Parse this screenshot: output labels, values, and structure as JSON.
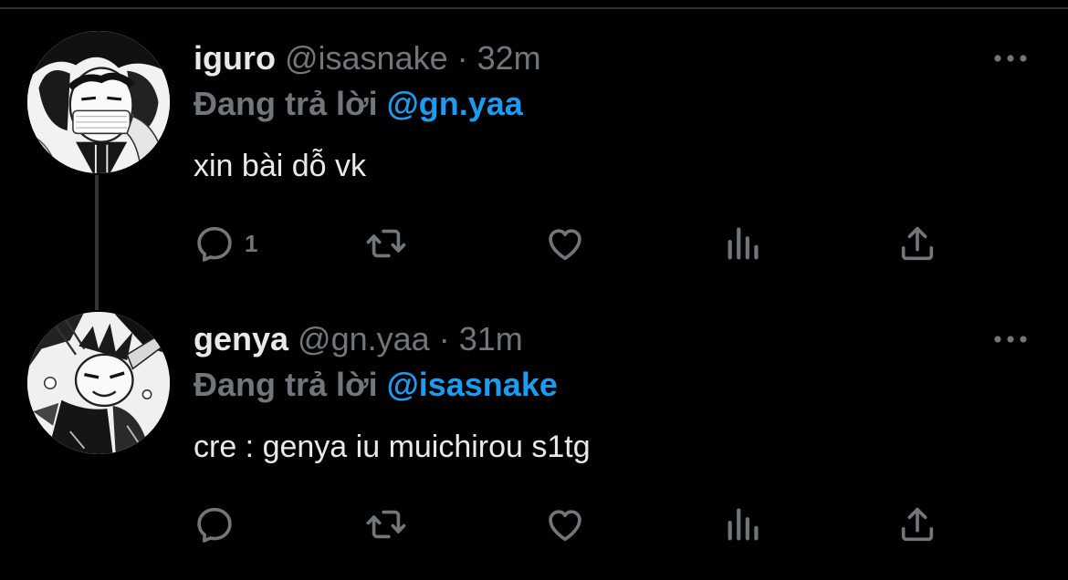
{
  "tweets": [
    {
      "name": "iguro",
      "handle": "@isasnake",
      "separator": "·",
      "time": "32m",
      "reply_prefix": "Đang trả lời",
      "reply_to": "@gn.yaa",
      "text": "xin bài dỗ vk",
      "reply_count": "1",
      "avatar_icon": "avatar-iguro",
      "more_icon": "more-icon"
    },
    {
      "name": "genya",
      "handle": "@gn.yaa",
      "separator": "·",
      "time": "31m",
      "reply_prefix": "Đang trả lời",
      "reply_to": "@isasnake",
      "text": "cre : genya iu muichirou s1tg",
      "reply_count": "",
      "avatar_icon": "avatar-genya",
      "more_icon": "more-icon"
    }
  ],
  "action_icons": [
    "reply-icon",
    "retweet-icon",
    "like-icon",
    "views-icon",
    "share-icon"
  ],
  "colors": {
    "background": "#000000",
    "text": "#e7e9ea",
    "secondary": "#71767b",
    "accent": "#1d9bf0",
    "thread_line": "#333639"
  }
}
